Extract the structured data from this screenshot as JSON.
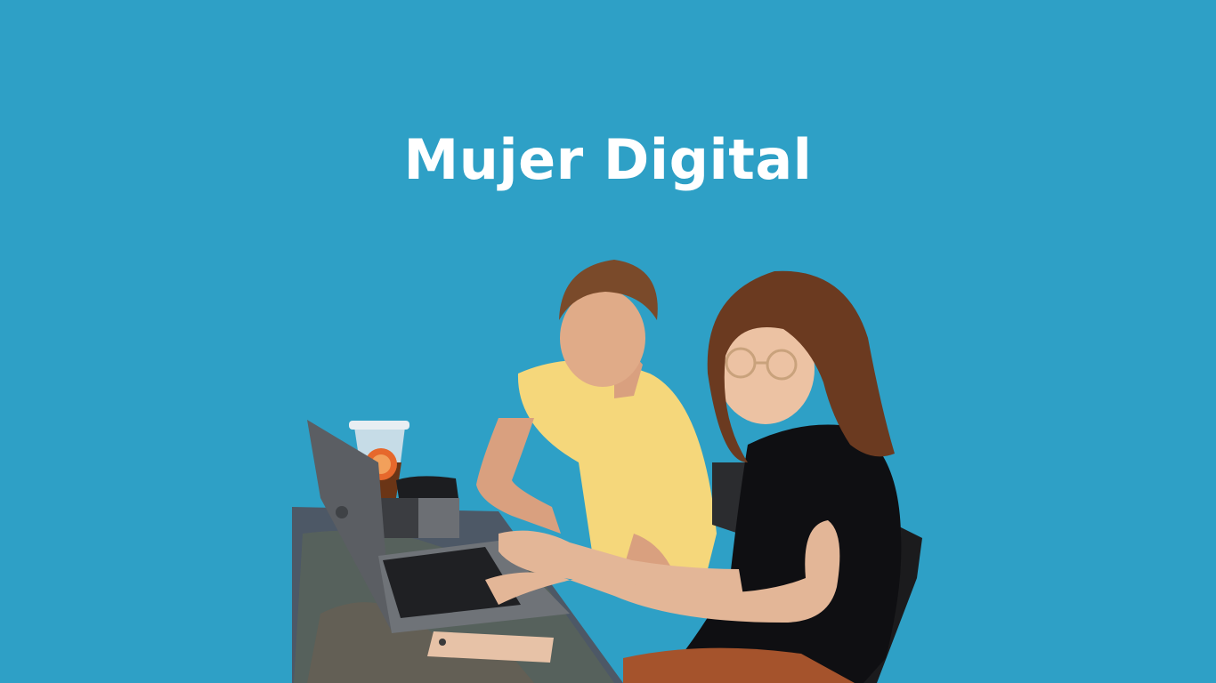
{
  "slide": {
    "title": "Mujer Digital",
    "background_color": "#2ea0c6"
  },
  "illustration": {
    "subject": "two-women-working-on-laptop",
    "items": [
      "laptop-icon",
      "second-laptop-icon",
      "iced-drink-icon",
      "smartphone-icon",
      "chair-icon",
      "table-icon"
    ]
  }
}
